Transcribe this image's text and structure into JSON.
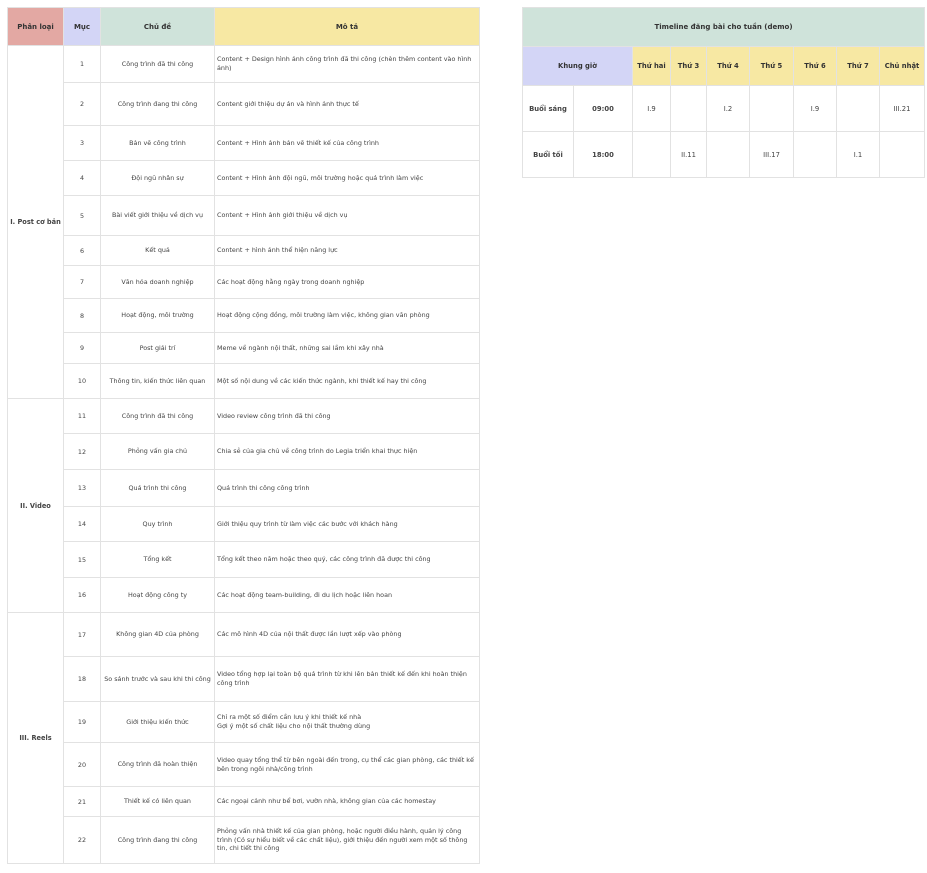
{
  "plan": {
    "headers": {
      "category": "Phân loại",
      "no": "Mục",
      "topic": "Chủ đề",
      "description": "Mô tả"
    },
    "groups": [
      {
        "name": "I. Post cơ bản",
        "rows": [
          {
            "no": "1",
            "topic": "Công trình đã thi công",
            "description": "Content + Design hình ảnh công trình đã thi công (chèn thêm content vào hình ảnh)"
          },
          {
            "no": "2",
            "topic": "Công trình đang thi công",
            "description": "Content giới thiệu dự án và hình ảnh thực tế"
          },
          {
            "no": "3",
            "topic": "Bản vẽ công trình",
            "description": "Content + Hình  ảnh bản vẽ thiết kế của công trình"
          },
          {
            "no": "4",
            "topic": "Đội ngũ nhân sự",
            "description": "Content + Hình ảnh đội ngũ, môi trường hoặc quá trình làm việc"
          },
          {
            "no": "5",
            "topic": "Bài viết giới thiệu về dịch vụ",
            "description": "Content + Hình ảnh giới thiệu về dịch vụ"
          },
          {
            "no": "6",
            "topic": "Kết quả",
            "description": "Content + hình ảnh thể hiện năng lực"
          },
          {
            "no": "7",
            "topic": "Văn hóa doanh nghiệp",
            "description": "Các hoạt động hằng ngày trong doanh nghiệp"
          },
          {
            "no": "8",
            "topic": "Hoạt động, môi trường",
            "description": "Hoạt động cộng đồng, môi trường làm việc, không gian văn phòng"
          },
          {
            "no": "9",
            "topic": "Post giải trí",
            "description": "Meme về ngành nội thất, những sai lầm khi xây nhà"
          },
          {
            "no": "10",
            "topic": "Thông tin, kiến thức liên quan",
            "description": "Một số nội dung về các kiến thức ngành, khi thiết kế hay thi công"
          }
        ]
      },
      {
        "name": "II. Video",
        "rows": [
          {
            "no": "11",
            "topic": "Công trình đã thi công",
            "description": "Video review công trình đã thi công"
          },
          {
            "no": "12",
            "topic": "Phỏng vấn gia chủ",
            "description": "Chia sẻ của gia chủ về công trình do Legia triển khai thực hiện"
          },
          {
            "no": "13",
            "topic": "Quá trình thi công",
            "description": "Quá trình thi công công trình"
          },
          {
            "no": "14",
            "topic": "Quy trình",
            "description": "Giới thiệu quy trình từ làm việc các bước với khách hàng"
          },
          {
            "no": "15",
            "topic": "Tổng kết",
            "description": "Tổng kết theo năm hoặc theo quý, các công trình đã được thi công"
          },
          {
            "no": "16",
            "topic": "Hoạt động công ty",
            "description": "Các hoạt động team-building, đi du lịch hoặc liên hoan"
          }
        ]
      },
      {
        "name": "III. Reels",
        "rows": [
          {
            "no": "17",
            "topic": "Không gian 4D của phòng",
            "description": "Các mô hình 4D của nội thất được lần lượt xếp vào phòng"
          },
          {
            "no": "18",
            "topic": "So sánh trước và sau khi thi công",
            "description": "Video tổng hợp lại toàn bộ quá trình từ khi lên bản thiết kế đến khi hoàn thiện công trình"
          },
          {
            "no": "19",
            "topic": "Giới thiệu kiến thức",
            "description": "Chỉ ra một số điểm cần lưu ý khi thiết kế nhà\nGợi ý một số chất liệu cho nội thất thường dùng"
          },
          {
            "no": "20",
            "topic": "Công trình đã hoàn thiện",
            "description": "Video quay tổng thể từ bên ngoài đến trong, cụ thể các gian phòng, các thiết kế bên trong ngôi nhà/công trình"
          },
          {
            "no": "21",
            "topic": "Thiết kế có liên quan",
            "description": "Các ngoại cảnh như bể bơi, vườn nhà, không gian của các homestay"
          },
          {
            "no": "22",
            "topic": "Công trình đang thi công",
            "description": "Phỏng vấn nhà thiết kế của gian phòng, hoặc người điều hành, quản lý công trình (Có sự hiểu biết về các chất liệu), giới thiệu đến người xem một số thông tin, chi tiết thi công"
          }
        ]
      }
    ]
  },
  "timeline": {
    "title": "Timeline đăng bài cho tuần (demo)",
    "slot_header": "Khung giờ",
    "days": [
      "Thứ hai",
      "Thứ 3",
      "Thứ 4",
      "Thứ 5",
      "Thứ 6",
      "Thứ 7",
      "Chủ nhật"
    ],
    "rows": [
      {
        "period": "Buổi sáng",
        "time": "09:00",
        "cells": [
          "I.9",
          "",
          "I.2",
          "",
          "I.9",
          "",
          "III.21"
        ]
      },
      {
        "period": "Buổi tối",
        "time": "18:00",
        "cells": [
          "",
          "II.11",
          "",
          "III.17",
          "",
          "I.1",
          ""
        ]
      }
    ]
  }
}
